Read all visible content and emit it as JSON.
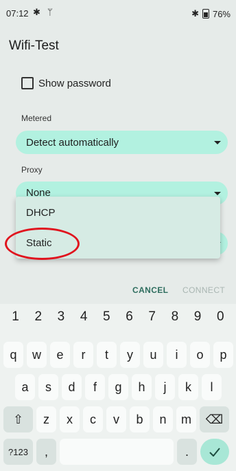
{
  "status_bar": {
    "time": "07:12",
    "battery": "76%"
  },
  "title": "Wifi-Test",
  "show_password": "Show password",
  "metered": {
    "label": "Metered",
    "value": "Detect automatically"
  },
  "proxy": {
    "label": "Proxy",
    "value": "None"
  },
  "menu": {
    "items": [
      "DHCP",
      "Static"
    ]
  },
  "buttons": {
    "cancel": "CANCEL",
    "connect": "CONNECT"
  },
  "keyboard": {
    "numbers": [
      "1",
      "2",
      "3",
      "4",
      "5",
      "6",
      "7",
      "8",
      "9",
      "0"
    ],
    "row1": [
      "q",
      "w",
      "e",
      "r",
      "t",
      "y",
      "u",
      "i",
      "o",
      "p"
    ],
    "row2": [
      "a",
      "s",
      "d",
      "f",
      "g",
      "h",
      "j",
      "k",
      "l"
    ],
    "row3": [
      "z",
      "x",
      "c",
      "v",
      "b",
      "n",
      "m"
    ],
    "symbols": "?123",
    "comma": ",",
    "period": "."
  }
}
